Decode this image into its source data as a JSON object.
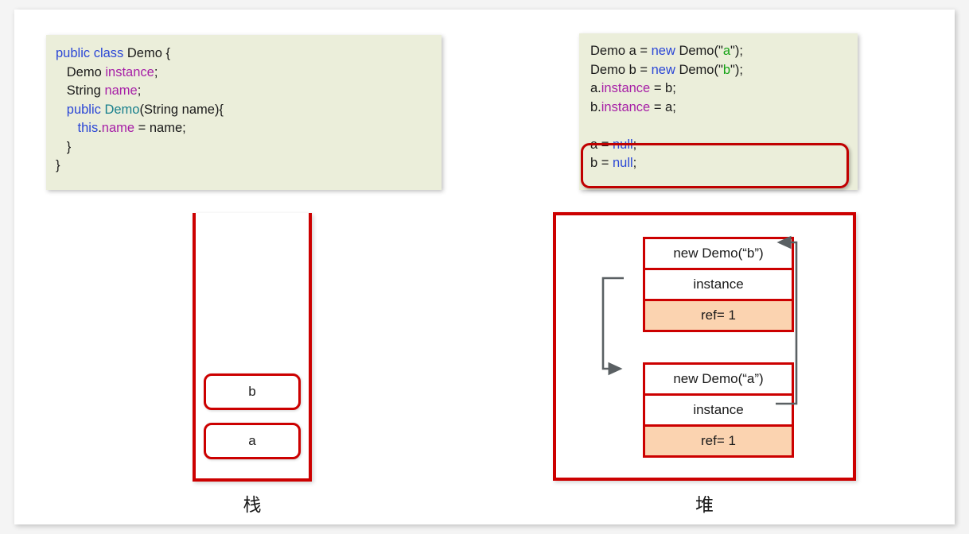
{
  "code_left": {
    "name": "demo-class-definition",
    "lines": [
      [
        {
          "t": "public class ",
          "c": "kw"
        },
        {
          "t": "Demo {",
          "c": "plain"
        }
      ],
      [
        {
          "t": "   Demo ",
          "c": "plain"
        },
        {
          "t": "instance",
          "c": "field"
        },
        {
          "t": ";",
          "c": "plain"
        }
      ],
      [
        {
          "t": "   String ",
          "c": "plain"
        },
        {
          "t": "name",
          "c": "field"
        },
        {
          "t": ";",
          "c": "plain"
        }
      ],
      [
        {
          "t": "   ",
          "c": "plain"
        },
        {
          "t": "public ",
          "c": "kw"
        },
        {
          "t": "Demo",
          "c": "ctor"
        },
        {
          "t": "(String name){",
          "c": "plain"
        }
      ],
      [
        {
          "t": "      ",
          "c": "plain"
        },
        {
          "t": "this",
          "c": "kw"
        },
        {
          "t": ".",
          "c": "plain"
        },
        {
          "t": "name",
          "c": "field"
        },
        {
          "t": " = name;",
          "c": "plain"
        }
      ],
      [
        {
          "t": "   }",
          "c": "plain"
        }
      ],
      [
        {
          "t": "}",
          "c": "plain"
        }
      ]
    ]
  },
  "code_right": {
    "name": "demo-usage-snippet",
    "lines": [
      [
        {
          "t": "Demo a = ",
          "c": "plain"
        },
        {
          "t": "new ",
          "c": "kw"
        },
        {
          "t": "Demo(\"",
          "c": "plain"
        },
        {
          "t": "a",
          "c": "str"
        },
        {
          "t": "\");",
          "c": "plain"
        }
      ],
      [
        {
          "t": "Demo b = ",
          "c": "plain"
        },
        {
          "t": "new ",
          "c": "kw"
        },
        {
          "t": "Demo(\"",
          "c": "plain"
        },
        {
          "t": "b",
          "c": "str"
        },
        {
          "t": "\");",
          "c": "plain"
        }
      ],
      [
        {
          "t": "a.",
          "c": "plain"
        },
        {
          "t": "instance",
          "c": "field"
        },
        {
          "t": " = b;",
          "c": "plain"
        }
      ],
      [
        {
          "t": "b.",
          "c": "plain"
        },
        {
          "t": "instance",
          "c": "field"
        },
        {
          "t": " = a;",
          "c": "plain"
        }
      ],
      [
        {
          "t": " ",
          "c": "plain"
        }
      ],
      [
        {
          "t": "a = ",
          "c": "plain"
        },
        {
          "t": "null",
          "c": "kw"
        },
        {
          "t": ";",
          "c": "plain"
        }
      ],
      [
        {
          "t": "b = ",
          "c": "plain"
        },
        {
          "t": "null",
          "c": "kw"
        },
        {
          "t": ";",
          "c": "plain"
        }
      ]
    ]
  },
  "stack": {
    "caption": "栈",
    "frames": [
      {
        "label": "b"
      },
      {
        "label": "a"
      }
    ]
  },
  "heap": {
    "caption": "堆",
    "objects": [
      {
        "id": "object-b",
        "cells": [
          {
            "label": "new Demo(“b”)",
            "kind": "title"
          },
          {
            "label": "instance",
            "kind": "field"
          },
          {
            "label": "ref= 1",
            "kind": "ref"
          }
        ]
      },
      {
        "id": "object-a",
        "cells": [
          {
            "label": "new Demo(“a”)",
            "kind": "title"
          },
          {
            "label": "instance",
            "kind": "field"
          },
          {
            "label": "ref= 1",
            "kind": "ref"
          }
        ]
      }
    ]
  },
  "colors": {
    "red_border": "#cc0000",
    "highlight_red": "#c00000",
    "code_bg": "#ebeeda",
    "ref_cell_bg": "#fbd3b0",
    "arrow_gray": "#5a6063",
    "keyword_blue": "#2b47d6",
    "field_purple": "#a720a7",
    "string_green": "#15a215",
    "ctor_teal": "#187f8c",
    "page_bg": "#f4f4f4",
    "card_bg": "#ffffff"
  },
  "arrows": [
    {
      "name": "b-instance-to-a-object",
      "from": "object-b.instance",
      "to": "object-a.title"
    },
    {
      "name": "a-instance-to-b-object",
      "from": "object-a.instance",
      "to": "object-b.title"
    }
  ]
}
